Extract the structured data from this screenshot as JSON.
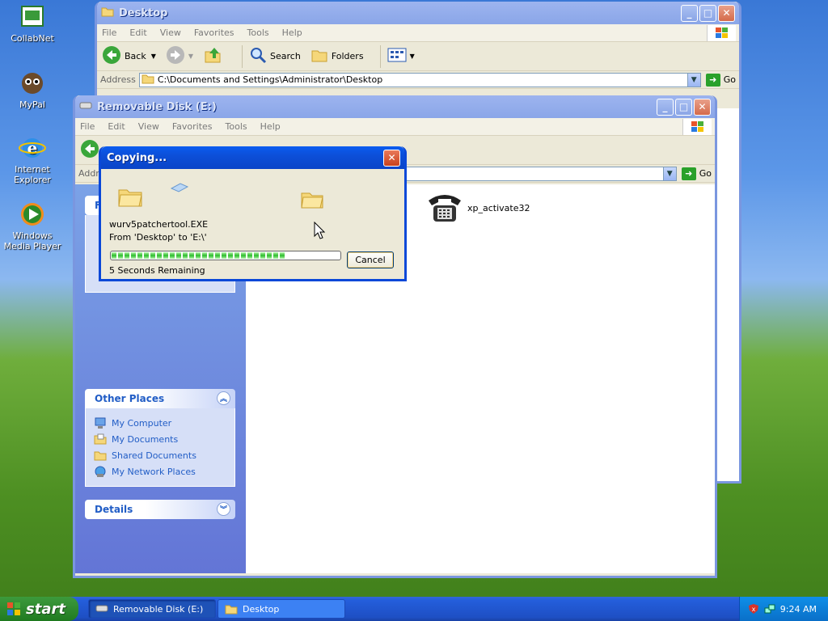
{
  "desktop_icons": [
    {
      "label": "CollabNet",
      "icon": "collabnet-icon"
    },
    {
      "label": "MyPal",
      "icon": "mypal-icon"
    },
    {
      "label": "Internet Explorer",
      "icon": "internet-explorer-icon"
    },
    {
      "label": "Windows Media Player",
      "icon": "windows-media-player-icon"
    }
  ],
  "window_desktop": {
    "title": "Desktop",
    "menu": [
      "File",
      "Edit",
      "View",
      "Favorites",
      "Tools",
      "Help"
    ],
    "toolbar": {
      "back": "Back",
      "search": "Search",
      "folders": "Folders"
    },
    "address_label": "Address",
    "address_value": "C:\\Documents and Settings\\Administrator\\Desktop",
    "go": "Go"
  },
  "window_removable": {
    "title": "Removable Disk (E:)",
    "menu": [
      "File",
      "Edit",
      "View",
      "Favorites",
      "Tools",
      "Help"
    ],
    "address_label": "Addr",
    "go": "Go",
    "task_first_letter": "F",
    "other_places": {
      "title": "Other Places",
      "links": [
        "My Computer",
        "My Documents",
        "Shared Documents",
        "My Network Places"
      ]
    },
    "details": {
      "title": "Details"
    },
    "file": {
      "name": "xp_activate32",
      "icon": "telephone-icon"
    }
  },
  "copy_dialog": {
    "title": "Copying...",
    "filename": "wurv5patchertool.EXE",
    "from_to": "From 'Desktop' to 'E:\\'",
    "remaining": "5 Seconds Remaining",
    "cancel": "Cancel",
    "progress_percent": 78
  },
  "taskbar": {
    "start": "start",
    "tasks": [
      {
        "label": "Removable Disk (E:)",
        "active": true
      },
      {
        "label": "Desktop",
        "active": false
      }
    ],
    "clock": "9:24 AM"
  }
}
